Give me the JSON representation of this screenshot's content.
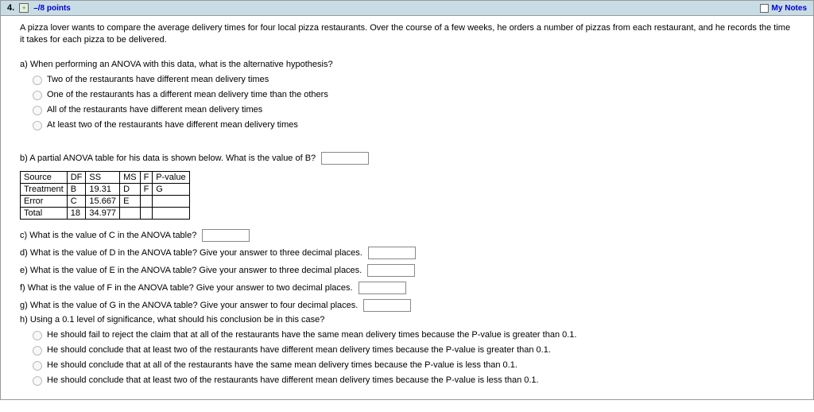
{
  "header": {
    "number": "4.",
    "points": "–/8 points",
    "my_notes": "My Notes"
  },
  "intro": "A pizza lover wants to compare the average delivery times for four local pizza restaurants. Over the course of a few weeks, he orders a number of pizzas from each restaurant, and he records the time it takes for each pizza to be delivered.",
  "part_a": {
    "prompt": "a) When performing an ANOVA with this data, what is the alternative hypothesis?",
    "opts": [
      "Two of the restaurants have different mean delivery times",
      "One of the restaurants has a different mean delivery time than the others",
      "All of the restaurants have different mean delivery times",
      "At least two of the restaurants have different mean delivery times"
    ]
  },
  "part_b": {
    "prompt": "b) A partial ANOVA table for his data is shown below. What is the value of B?",
    "table": {
      "headers": [
        "Source",
        "DF",
        "SS",
        "MS",
        "F",
        "P-value"
      ],
      "rows": [
        [
          "Treatment",
          "B",
          "19.31",
          "D",
          "F",
          "G"
        ],
        [
          "Error",
          "C",
          "15.667",
          "E",
          "",
          ""
        ],
        [
          "Total",
          "18",
          "34.977",
          "",
          "",
          ""
        ]
      ]
    }
  },
  "part_c": "c) What is the value of C in the ANOVA table?",
  "part_d": "d) What is the value of D in the ANOVA table? Give your answer to three decimal places.",
  "part_e": "e) What is the value of E in the ANOVA table? Give your answer to three decimal places.",
  "part_f": "f) What is the value of F in the ANOVA table? Give your answer to two decimal places.",
  "part_g": "g) What is the value of G in the ANOVA table? Give your answer to four decimal places.",
  "part_h": {
    "prompt": "h) Using a 0.1 level of significance, what should his conclusion be in this case?",
    "opts": [
      "He should fail to reject the claim that at all of the restaurants have the same mean delivery times because the P-value is greater than 0.1.",
      "He should conclude that at least two of the restaurants have different mean delivery times because the P-value is greater than 0.1.",
      "He should conclude that at all of the restaurants have the same mean delivery times because the P-value is less than 0.1.",
      "He should conclude that at least two of the restaurants have different mean delivery times because the P-value is less than 0.1."
    ]
  }
}
